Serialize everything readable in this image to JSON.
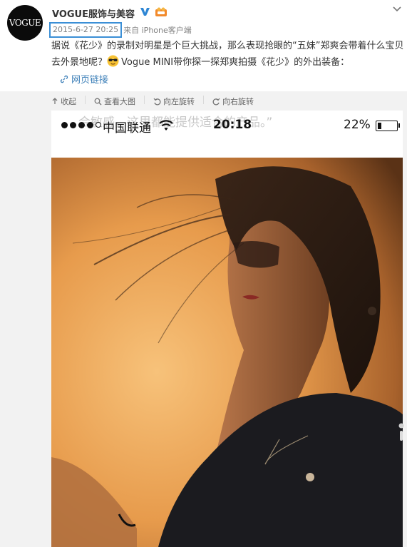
{
  "post": {
    "username": "VOGUE服饰与美容",
    "avatar_text": "VOGUE",
    "timestamp": "2015-6-27 20:25",
    "source_prefix": "来自",
    "source_name": "iPhone客户端",
    "text_part1": "据说《花少》的录制对明星是个巨大挑战，那么表现抢眼的“五妹”郑爽会带着什么宝贝去外景地呢？",
    "text_part2": "Vogue MINI带你探一探郑爽拍摄《花少》的外出装备：",
    "web_link": "网页链接"
  },
  "toolbar": {
    "collapse": "收起",
    "view_large": "查看大图",
    "rotate_left": "向左旋转",
    "rotate_right": "向右旋转"
  },
  "phone_status": {
    "carrier": "中国联通",
    "time": "20:18",
    "battery": "22%",
    "ghost_text": "会敏感，这里都能提供适合的产品。”"
  },
  "colors": {
    "link": "#3c7fb8",
    "highlight_box": "#3b8fd6",
    "media_bg": "#f2f2f2"
  },
  "icons": [
    "verified-icon",
    "vip-icon",
    "chevron-down-icon",
    "sunglasses-emoji-icon",
    "link-icon",
    "collapse-icon",
    "zoom-icon",
    "rotate-left-icon",
    "rotate-right-icon",
    "wifi-icon",
    "battery-icon"
  ]
}
